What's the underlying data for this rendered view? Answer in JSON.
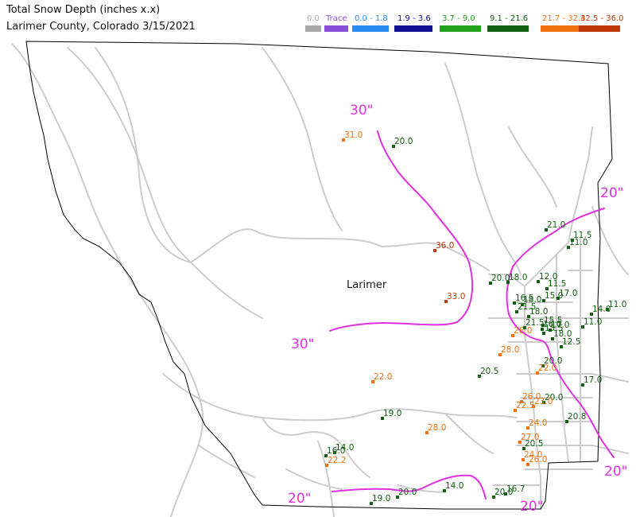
{
  "header": {
    "title_line1": "Total Snow Depth (inches  x.x)",
    "title_line2": "Larimer County, Colorado  3/15/2021"
  },
  "legend": [
    {
      "label": "0.0",
      "color": "#a8a8a8"
    },
    {
      "label": "Trace",
      "color": "#8a4fd8"
    },
    {
      "label": "0.0 - 1.8",
      "color": "#2a8cf0"
    },
    {
      "label": "1.9 - 3.6",
      "color": "#101090"
    },
    {
      "label": "3.7 - 9.0",
      "color": "#22a01e"
    },
    {
      "label": "9.1 - 21.6",
      "color": "#106010"
    },
    {
      "label": "21.7 - 32.4",
      "color": "#f07010"
    },
    {
      "label": "32.5 - 36.0",
      "color": "#c03808"
    }
  ],
  "map": {
    "county_label": "Larimer",
    "contours": [
      {
        "label": "30\"",
        "color": "#e030e0"
      },
      {
        "label": "30\"",
        "color": "#e030e0"
      },
      {
        "label": "20\"",
        "color": "#e030e0"
      },
      {
        "label": "20\"",
        "color": "#e030e0"
      },
      {
        "label": "20\"",
        "color": "#e030e0"
      },
      {
        "label": "20\"",
        "color": "#e030e0"
      }
    ],
    "stations": [
      {
        "value": "31.0",
        "cls": "orange"
      },
      {
        "value": "20.0",
        "cls": "dgreen"
      },
      {
        "value": "36.0",
        "cls": "red"
      },
      {
        "value": "33.0",
        "cls": "red"
      },
      {
        "value": "21.0",
        "cls": "dgreen"
      },
      {
        "value": "11.5",
        "cls": "dgreen"
      },
      {
        "value": "11.0",
        "cls": "dgreen"
      },
      {
        "value": "20.0",
        "cls": "dgreen"
      },
      {
        "value": "18.0",
        "cls": "dgreen"
      },
      {
        "value": "12.0",
        "cls": "dgreen"
      },
      {
        "value": "11.5",
        "cls": "dgreen"
      },
      {
        "value": "15.0",
        "cls": "dgreen"
      },
      {
        "value": "17.0",
        "cls": "dgreen"
      },
      {
        "value": "16.5",
        "cls": "dgreen"
      },
      {
        "value": "18.0",
        "cls": "dgreen"
      },
      {
        "value": "21.5",
        "cls": "dgreen"
      },
      {
        "value": "18.0",
        "cls": "dgreen"
      },
      {
        "value": "15.5",
        "cls": "dgreen"
      },
      {
        "value": "21.5",
        "cls": "dgreen"
      },
      {
        "value": "16.0",
        "cls": "dgreen"
      },
      {
        "value": "17.0",
        "cls": "dgreen"
      },
      {
        "value": "26.0",
        "cls": "orange"
      },
      {
        "value": "15.5",
        "cls": "dgreen"
      },
      {
        "value": "18.0",
        "cls": "dgreen"
      },
      {
        "value": "14.0",
        "cls": "dgreen"
      },
      {
        "value": "11.0",
        "cls": "dgreen"
      },
      {
        "value": "11.0",
        "cls": "dgreen"
      },
      {
        "value": "12.5",
        "cls": "dgreen"
      },
      {
        "value": "28.0",
        "cls": "orange"
      },
      {
        "value": "20.0",
        "cls": "dgreen"
      },
      {
        "value": "22.0",
        "cls": "orange"
      },
      {
        "value": "20.5",
        "cls": "dgreen"
      },
      {
        "value": "17.0",
        "cls": "dgreen"
      },
      {
        "value": "22.0",
        "cls": "orange"
      },
      {
        "value": "26.0",
        "cls": "orange"
      },
      {
        "value": "20.0",
        "cls": "dgreen"
      },
      {
        "value": "22.5",
        "cls": "orange"
      },
      {
        "value": "23.0",
        "cls": "orange"
      },
      {
        "value": "19.0",
        "cls": "dgreen"
      },
      {
        "value": "20.8",
        "cls": "dgreen"
      },
      {
        "value": "28.0",
        "cls": "orange"
      },
      {
        "value": "24.0",
        "cls": "orange"
      },
      {
        "value": "27.0",
        "cls": "orange"
      },
      {
        "value": "20.5",
        "cls": "dgreen"
      },
      {
        "value": "16.0",
        "cls": "dgreen"
      },
      {
        "value": "14.0",
        "cls": "dgreen"
      },
      {
        "value": "22.2",
        "cls": "orange"
      },
      {
        "value": "24.0",
        "cls": "orange"
      },
      {
        "value": "26.0",
        "cls": "orange"
      },
      {
        "value": "14.0",
        "cls": "dgreen"
      },
      {
        "value": "16.7",
        "cls": "dgreen"
      },
      {
        "value": "20.0",
        "cls": "dgreen"
      },
      {
        "value": "19.0",
        "cls": "dgreen"
      },
      {
        "value": "20.0",
        "cls": "dgreen"
      }
    ]
  }
}
